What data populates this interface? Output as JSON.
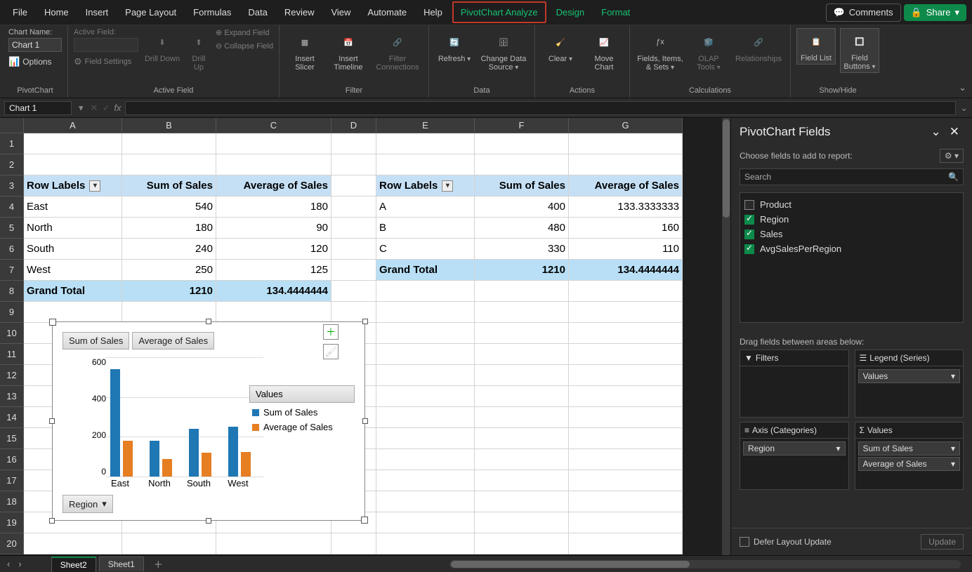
{
  "menubar": {
    "items": [
      "File",
      "Home",
      "Insert",
      "Page Layout",
      "Formulas",
      "Data",
      "Review",
      "View",
      "Automate",
      "Help"
    ],
    "extra": [
      "PivotChart Analyze",
      "Design",
      "Format"
    ],
    "comments": "Comments",
    "share": "Share"
  },
  "ribbon": {
    "chartname_label": "Chart Name:",
    "chartname_value": "Chart 1",
    "options": "Options",
    "pivotchart": "PivotChart",
    "active_field_label": "Active Field:",
    "drill_down": "Drill Down",
    "drill_up": "Drill Up",
    "expand": "Expand Field",
    "collapse": "Collapse Field",
    "field_settings": "Field Settings",
    "active_field_group": "Active Field",
    "insert_slicer": "Insert Slicer",
    "insert_timeline": "Insert Timeline",
    "filter_conn": "Filter Connections",
    "filter_group": "Filter",
    "refresh": "Refresh",
    "change_ds": "Change Data Source",
    "data_group": "Data",
    "clear": "Clear",
    "move_chart": "Move Chart",
    "actions_group": "Actions",
    "fis": "Fields, Items, & Sets",
    "olap": "OLAP Tools",
    "rel": "Relationships",
    "calc_group": "Calculations",
    "field_list": "Field List",
    "field_buttons": "Field Buttons",
    "showhide": "Show/Hide"
  },
  "namebox": "Chart 1",
  "headers": {
    "A": "A",
    "B": "B",
    "C": "C",
    "D": "D",
    "E": "E",
    "F": "F",
    "G": "G"
  },
  "col_widths": {
    "A": 140,
    "B": 134,
    "C": 164,
    "D": 64,
    "E": 140,
    "F": 134,
    "G": 162
  },
  "rows": [
    "1",
    "2",
    "3",
    "4",
    "5",
    "6",
    "7",
    "8",
    "9",
    "10",
    "11",
    "12",
    "13",
    "14",
    "15",
    "16",
    "17",
    "18",
    "19",
    "20"
  ],
  "table1": {
    "h1": "Row Labels",
    "h2": "Sum of Sales",
    "h3": "Average of Sales",
    "r": [
      [
        "East",
        "540",
        "180"
      ],
      [
        "North",
        "180",
        "90"
      ],
      [
        "South",
        "240",
        "120"
      ],
      [
        "West",
        "250",
        "125"
      ]
    ],
    "gt": [
      "Grand Total",
      "1210",
      "134.4444444"
    ]
  },
  "table2": {
    "h1": "Row Labels",
    "h2": "Sum of Sales",
    "h3": "Average of Sales",
    "r": [
      [
        "A",
        "400",
        "133.3333333"
      ],
      [
        "B",
        "480",
        "160"
      ],
      [
        "C",
        "330",
        "110"
      ]
    ],
    "gt": [
      "Grand Total",
      "1210",
      "134.4444444"
    ]
  },
  "chart": {
    "val_buttons": [
      "Sum of Sales",
      "Average of Sales"
    ],
    "legend_header": "Values",
    "legend": [
      "Sum of Sales",
      "Average of Sales"
    ],
    "region_label": "Region",
    "yticks": [
      "600",
      "400",
      "200",
      "0"
    ],
    "xticks": [
      "East",
      "North",
      "South",
      "West"
    ]
  },
  "chart_data": {
    "type": "bar",
    "categories": [
      "East",
      "North",
      "South",
      "West"
    ],
    "series": [
      {
        "name": "Sum of Sales",
        "values": [
          540,
          180,
          240,
          250
        ],
        "color": "#1f77b4"
      },
      {
        "name": "Average of Sales",
        "values": [
          180,
          90,
          120,
          125
        ],
        "color": "#e67e22"
      }
    ],
    "ylim": [
      0,
      600
    ]
  },
  "panel": {
    "title": "PivotChart Fields",
    "choose": "Choose fields to add to report:",
    "search": "Search",
    "fields": [
      {
        "name": "Product",
        "checked": false
      },
      {
        "name": "Region",
        "checked": true
      },
      {
        "name": "Sales",
        "checked": true
      },
      {
        "name": "AvgSalesPerRegion",
        "checked": true
      }
    ],
    "drag": "Drag fields between areas below:",
    "filters": "Filters",
    "legend": "Legend (Series)",
    "legend_items": [
      "Values"
    ],
    "axis": "Axis (Categories)",
    "axis_items": [
      "Region"
    ],
    "values": "Values",
    "values_items": [
      "Sum of Sales",
      "Average of Sales"
    ],
    "defer": "Defer Layout Update",
    "update": "Update"
  },
  "tabs": {
    "active": "Sheet2",
    "other": "Sheet1"
  }
}
